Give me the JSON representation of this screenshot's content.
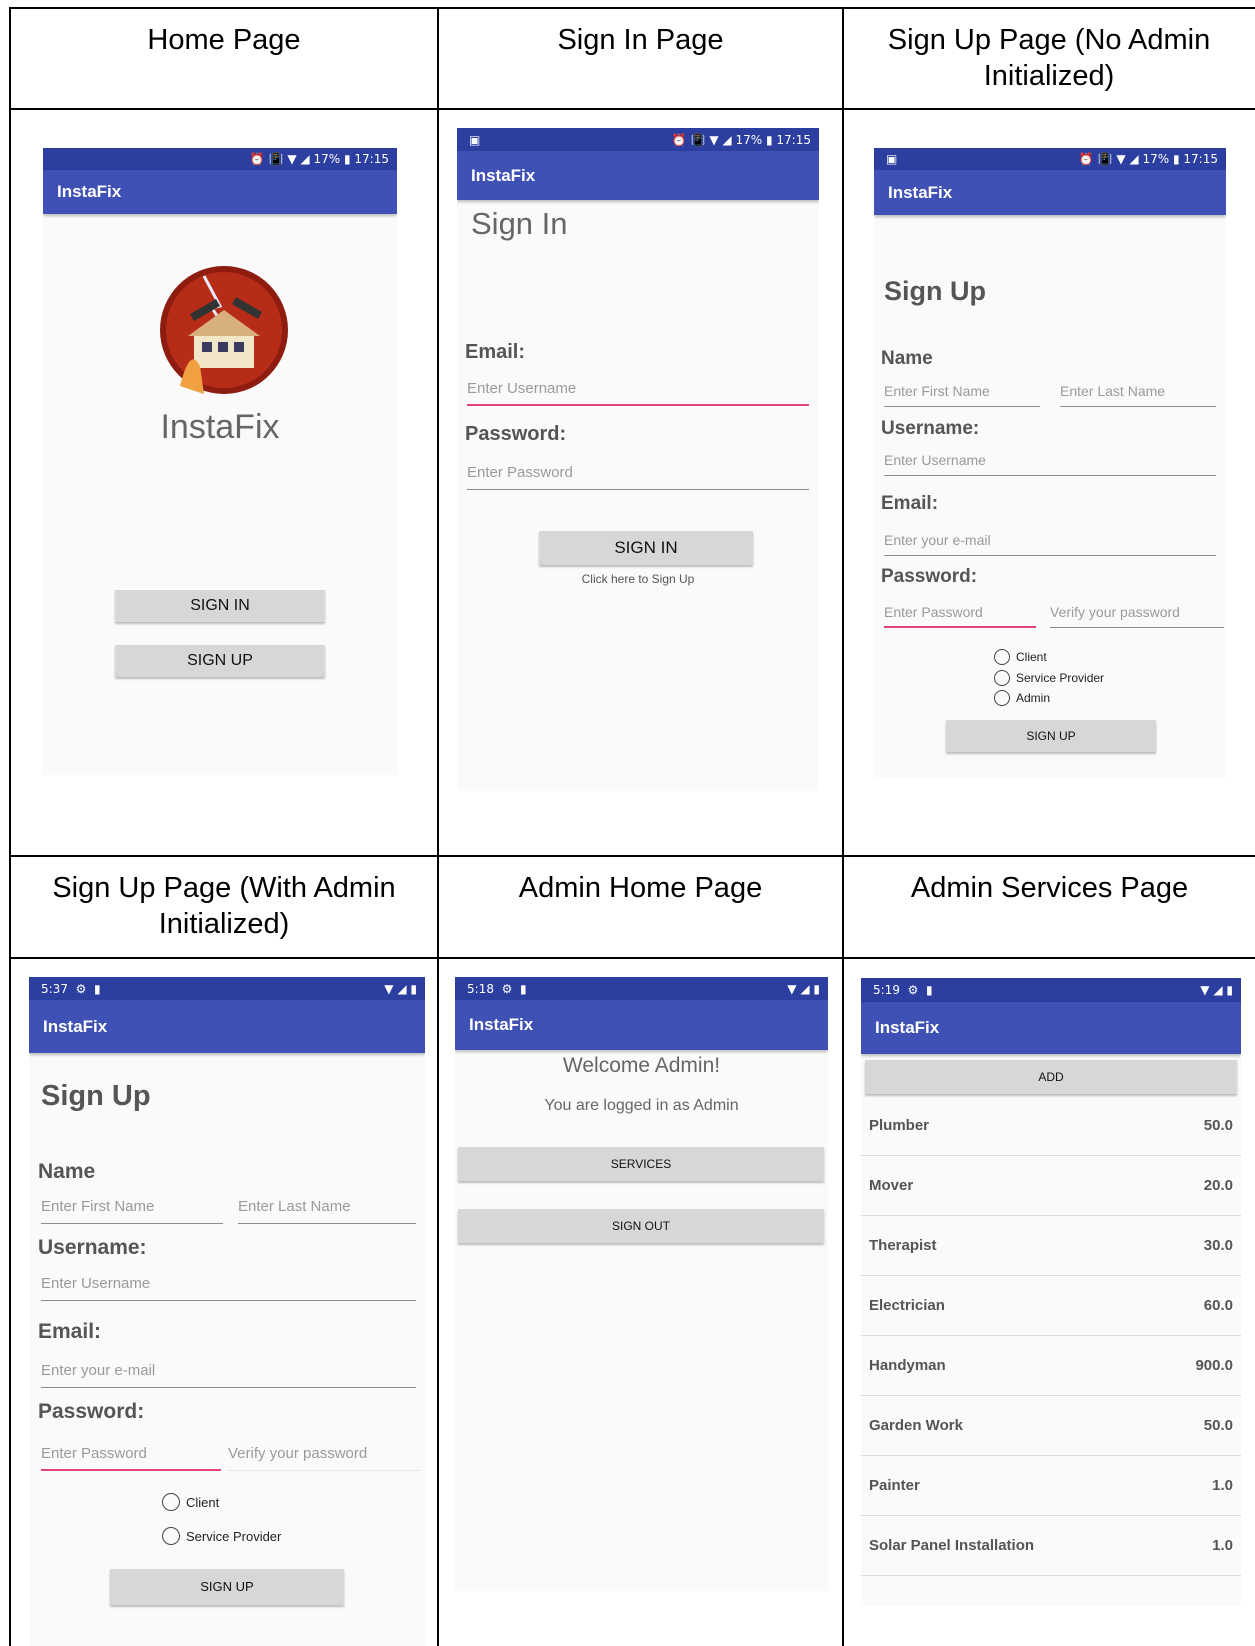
{
  "captions": {
    "home": "Home Page",
    "sign_in": "Sign In Page",
    "sign_up_no_admin": "Sign Up Page (No Admin Initialized)",
    "sign_up_admin": "Sign Up Page (With Admin Initialized)",
    "admin_home": "Admin Home Page",
    "admin_services": "Admin Services Page"
  },
  "status_bar": {
    "time_1715": "17:15",
    "battery": "17%",
    "time_537": "5:37",
    "time_518": "5:18",
    "time_519": "5:19"
  },
  "app": {
    "title": "InstaFix"
  },
  "home": {
    "app_name": "InstaFix",
    "sign_in_button": "SIGN IN",
    "sign_up_button": "SIGN UP"
  },
  "sign_in": {
    "heading": "Sign In",
    "email_label": "Email:",
    "email_placeholder": "Enter Username",
    "password_label": "Password:",
    "password_placeholder": "Enter Password",
    "sign_in_button": "SIGN IN",
    "sign_up_link": "Click here to Sign Up"
  },
  "sign_up": {
    "heading": "Sign Up",
    "name_label": "Name",
    "first_name_placeholder": "Enter First Name",
    "last_name_placeholder": "Enter Last Name",
    "username_label": "Username:",
    "username_placeholder": "Enter Username",
    "email_label": "Email:",
    "email_placeholder": "Enter your e-mail",
    "password_label": "Password:",
    "password_placeholder": "Enter Password",
    "verify_placeholder": "Verify your password",
    "role_client": "Client",
    "role_service_provider": "Service Provider",
    "role_admin": "Admin",
    "sign_up_button": "SIGN UP"
  },
  "admin_home": {
    "welcome": "Welcome Admin!",
    "logged_in": "You are logged in as Admin",
    "services_button": "SERVICES",
    "sign_out_button": "SIGN OUT"
  },
  "admin_services": {
    "add_button": "ADD",
    "services": [
      {
        "name": "Plumber",
        "price": "50.0"
      },
      {
        "name": "Mover",
        "price": "20.0"
      },
      {
        "name": "Therapist",
        "price": "30.0"
      },
      {
        "name": "Electrician",
        "price": "60.0"
      },
      {
        "name": "Handyman",
        "price": "900.0"
      },
      {
        "name": "Garden Work",
        "price": "50.0"
      },
      {
        "name": "Painter",
        "price": "1.0"
      },
      {
        "name": "Solar Panel Installation",
        "price": "1.0"
      }
    ]
  },
  "colors": {
    "status_bar": "#2c3fa0",
    "app_bar": "#3f51b5",
    "accent": "#e2407f",
    "button": "#d6d7d7"
  }
}
